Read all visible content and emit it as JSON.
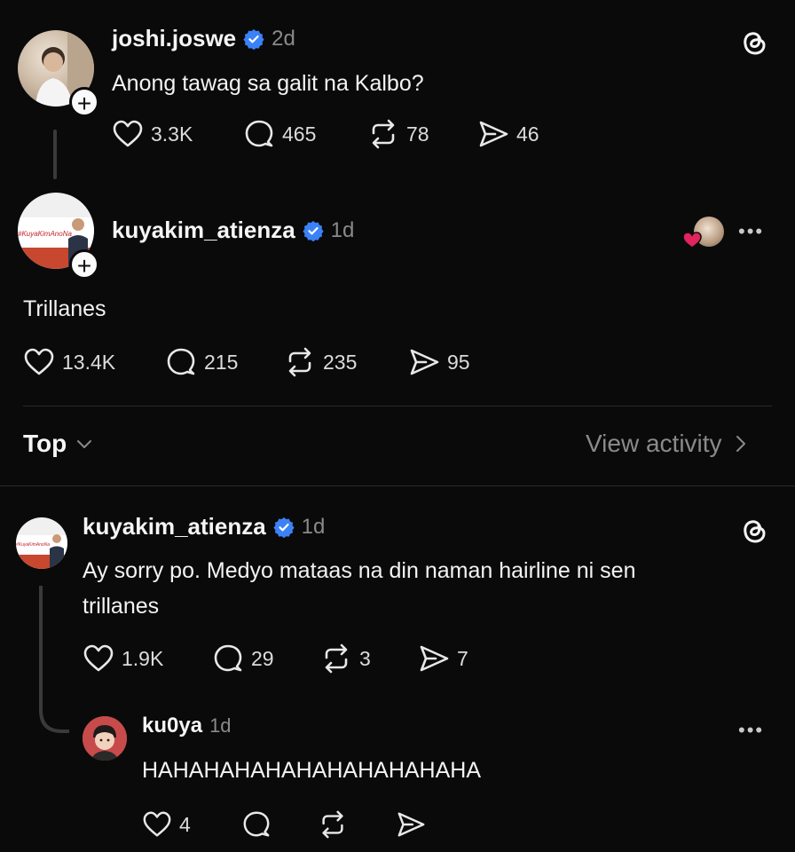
{
  "post1": {
    "username": "joshi.joswe",
    "time": "2d",
    "text": "Anong tawag sa galit na Kalbo?",
    "likes": "3.3K",
    "comments": "465",
    "reposts": "78",
    "shares": "46"
  },
  "post2": {
    "username": "kuyakim_atienza",
    "time": "1d",
    "avatar_caption": "#KuyaKimAnoNa",
    "text": "Trillanes",
    "likes": "13.4K",
    "comments": "215",
    "reposts": "235",
    "shares": "95"
  },
  "sort": {
    "label": "Top",
    "view_activity": "View activity"
  },
  "reply1": {
    "username": "kuyakim_atienza",
    "time": "1d",
    "avatar_caption": "#KuyaKimAnoNa",
    "text_line1": "Ay sorry po. Medyo mataas na din naman hairline ni sen",
    "text_line2": "trillanes",
    "likes": "1.9K",
    "comments": "29",
    "reposts": "3",
    "shares": "7"
  },
  "reply2": {
    "username": "ku0ya",
    "time": "1d",
    "text": "HAHAHAHAHAHAHAHAHAHAHA",
    "likes": "4"
  },
  "colors": {
    "background": "#0a0a0a",
    "verified_blue": "#3b82f6",
    "muted_text": "#8a8a8a",
    "liked_red": "#e0245e"
  }
}
